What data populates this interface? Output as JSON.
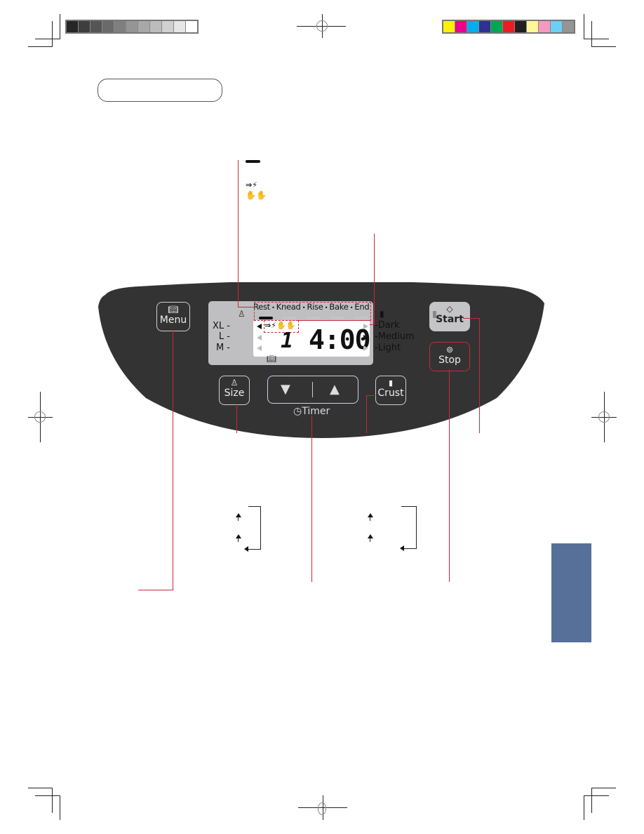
{
  "print_marks": {
    "gray_swatches": [
      "#262626",
      "#3e3e3e",
      "#555555",
      "#6a6a6a",
      "#7f7f7f",
      "#959595",
      "#a8a8a8",
      "#bcbcbc",
      "#d0d0d0",
      "#e6e6e6",
      "#ffffff"
    ],
    "color_swatches": [
      "#fff200",
      "#ec008c",
      "#00aeef",
      "#2e3192",
      "#00a651",
      "#ed1c24",
      "#231f20",
      "#fff799",
      "#f49ac1",
      "#6dcff6",
      "#959595"
    ]
  },
  "legend_icons": {
    "bar_icon": "progress-bar",
    "power_icon": "power-failure-icon",
    "hands_icon": "add-ingredients-icon"
  },
  "control_panel": {
    "menu_button": {
      "label": "Menu",
      "icon": "book-icon"
    },
    "lcd": {
      "phases": [
        "Rest",
        "Knead",
        "Rise",
        "Bake",
        "End"
      ],
      "phase_separator": "•",
      "active_phase_index": 0,
      "sizes": [
        "XL",
        "L",
        "M"
      ],
      "selected_size": "XL",
      "crusts": [
        "Dark",
        "Medium",
        "Light"
      ],
      "selected_crust": "Medium",
      "menu_number": "1",
      "time": "4:00"
    },
    "start_button": {
      "label": "Start",
      "icon": "start-diamond-icon"
    },
    "stop_button": {
      "label": "Stop",
      "icon": "stop-icon"
    },
    "size_button": {
      "label": "Size",
      "icon": "weight-icon"
    },
    "timer": {
      "label": "Timer",
      "down": "▼",
      "up": "▲"
    },
    "crust_button": {
      "label": "Crust",
      "icon": "bread-icon"
    }
  },
  "colors": {
    "panel": "#333333",
    "lcd": "#bfbfc1",
    "callout_line": "#c8283a",
    "side_tab": "#56709a"
  }
}
